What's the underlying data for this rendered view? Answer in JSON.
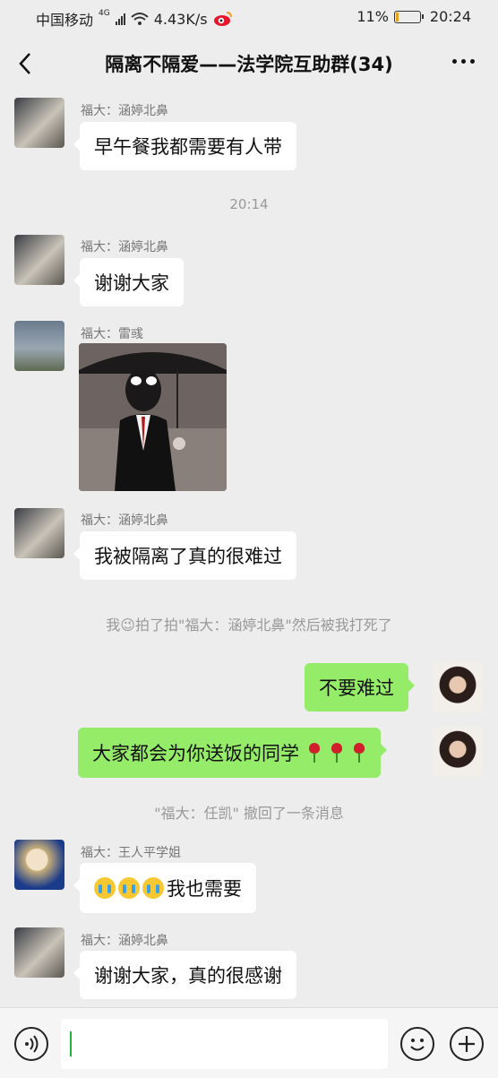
{
  "status_bar": {
    "carrier": "中国移动",
    "network": "4G",
    "speed": "4.43K/s",
    "battery": "11%",
    "battery_level": 0.11,
    "time": "20:24"
  },
  "header": {
    "title": "隔离不隔爱——法学院互助群(34)"
  },
  "messages": {
    "m1": {
      "sender": "福大：涵婷北鼻",
      "text": "早午餐我都需要有人带"
    },
    "t1": "20:14",
    "m2": {
      "sender": "福大：涵婷北鼻",
      "text": "谢谢大家"
    },
    "m3": {
      "sender": "福大：雷彧"
    },
    "m4": {
      "sender": "福大：涵婷北鼻",
      "text": "我被隔离了真的很难过"
    },
    "sys1": "我😉拍了拍\"福大：涵婷北鼻\"然后被我打死了",
    "o1": {
      "text": "不要难过"
    },
    "o2": {
      "text": "大家都会为你送饭的同学"
    },
    "sys2": "\"福大：任凯\" 撤回了一条消息",
    "m5": {
      "sender": "福大：王人平学姐",
      "text": "我也需要"
    },
    "m6": {
      "sender": "福大：涵婷北鼻",
      "text": "谢谢大家，真的很感谢"
    }
  },
  "input": {
    "value": ""
  }
}
